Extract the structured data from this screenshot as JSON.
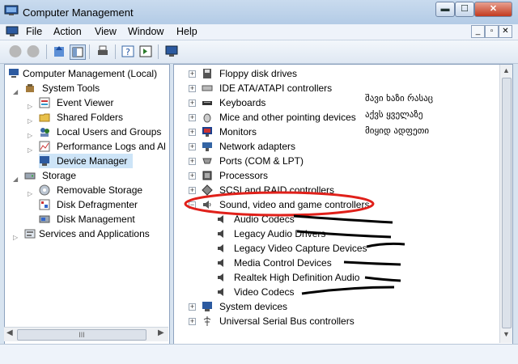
{
  "window": {
    "title": "Computer Management",
    "min_label": "▬",
    "max_label": "☐",
    "close_label": "✕"
  },
  "menu": [
    "File",
    "Action",
    "View",
    "Window",
    "Help"
  ],
  "mdi_buttons": [
    "_",
    "▫",
    "✕"
  ],
  "left_tree": [
    {
      "label": "Computer Management (Local)",
      "icon": "computer-icon"
    },
    {
      "label": "System Tools",
      "icon": "tools-icon"
    },
    {
      "label": "Event Viewer",
      "icon": "event-viewer-icon"
    },
    {
      "label": "Shared Folders",
      "icon": "shared-folder-icon"
    },
    {
      "label": "Local Users and Groups",
      "icon": "users-icon"
    },
    {
      "label": "Performance Logs and Al",
      "icon": "performance-icon"
    },
    {
      "label": "Device Manager",
      "icon": "device-manager-icon"
    },
    {
      "label": "Storage",
      "icon": "storage-icon"
    },
    {
      "label": "Removable Storage",
      "icon": "removable-storage-icon"
    },
    {
      "label": "Disk Defragmenter",
      "icon": "defrag-icon"
    },
    {
      "label": "Disk Management",
      "icon": "disk-management-icon"
    },
    {
      "label": "Services and Applications",
      "icon": "services-icon"
    }
  ],
  "device_tree": [
    {
      "label": "Floppy disk drives",
      "icon": "floppy-icon"
    },
    {
      "label": "IDE ATA/ATAPI controllers",
      "icon": "ide-icon"
    },
    {
      "label": "Keyboards",
      "icon": "keyboard-icon"
    },
    {
      "label": "Mice and other pointing devices",
      "icon": "mouse-icon"
    },
    {
      "label": "Monitors",
      "icon": "monitor-icon"
    },
    {
      "label": "Network adapters",
      "icon": "network-icon"
    },
    {
      "label": "Ports (COM & LPT)",
      "icon": "port-icon"
    },
    {
      "label": "Processors",
      "icon": "processor-icon"
    },
    {
      "label": "SCSI and RAID controllers",
      "icon": "scsi-icon"
    },
    {
      "label": "Sound, video and game controllers",
      "icon": "sound-icon"
    },
    {
      "label": "Audio Codecs",
      "icon": "audio-device-icon"
    },
    {
      "label": "Legacy Audio Drivers",
      "icon": "audio-device-icon"
    },
    {
      "label": "Legacy Video Capture Devices",
      "icon": "audio-device-icon"
    },
    {
      "label": "Media Control Devices",
      "icon": "audio-device-icon"
    },
    {
      "label": "Realtek High Definition Audio",
      "icon": "audio-device-icon"
    },
    {
      "label": "Video Codecs",
      "icon": "audio-device-icon"
    },
    {
      "label": "System devices",
      "icon": "system-icon"
    },
    {
      "label": "Universal Serial Bus controllers",
      "icon": "usb-icon"
    }
  ],
  "annotation": {
    "lines": [
      "შავი ხაზი რასაც",
      "აქვს ყველაზე",
      "მიყიდ ადფეთი"
    ],
    "color": "#000000",
    "circle_color": "#e0201a"
  },
  "hscroll_thumb": "III"
}
